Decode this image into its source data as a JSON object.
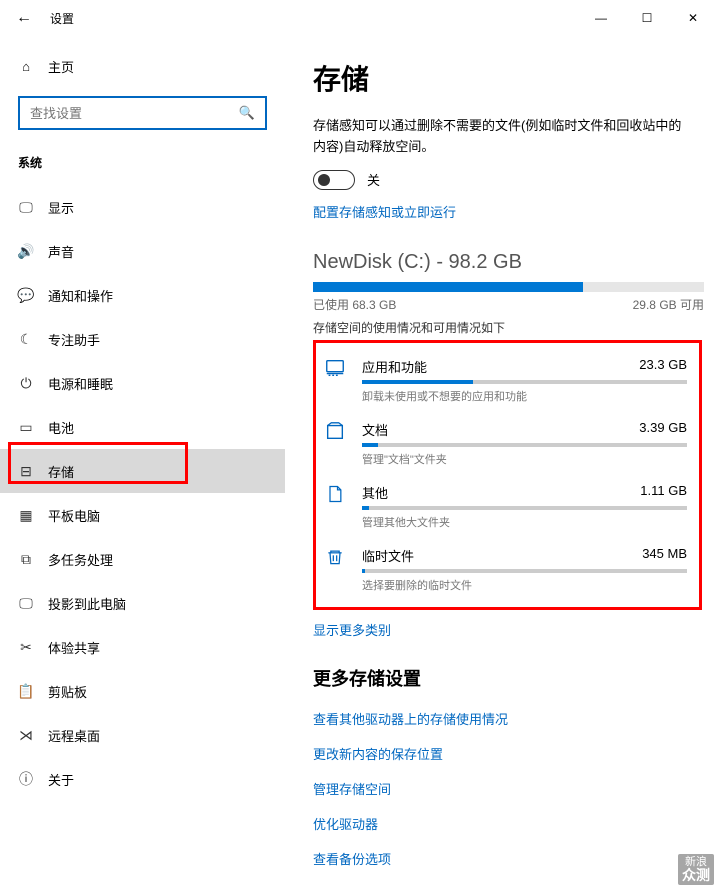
{
  "window": {
    "title": "设置",
    "min": "—",
    "max": "☐",
    "close": "✕",
    "back": "←"
  },
  "sidebar": {
    "home_label": "主页",
    "search_placeholder": "查找设置",
    "group_label": "系统",
    "items": [
      {
        "icon": "🖵",
        "label": "显示"
      },
      {
        "icon": "🔊",
        "label": "声音"
      },
      {
        "icon": "💬",
        "label": "通知和操作"
      },
      {
        "icon": "☾",
        "label": "专注助手"
      },
      {
        "icon": "⏻",
        "label": "电源和睡眠"
      },
      {
        "icon": "▭",
        "label": "电池"
      },
      {
        "icon": "⊟",
        "label": "存储"
      },
      {
        "icon": "▦",
        "label": "平板电脑"
      },
      {
        "icon": "⧉",
        "label": "多任务处理"
      },
      {
        "icon": "🖵",
        "label": "投影到此电脑"
      },
      {
        "icon": "✂",
        "label": "体验共享"
      },
      {
        "icon": "📋",
        "label": "剪贴板"
      },
      {
        "icon": "⋊",
        "label": "远程桌面"
      },
      {
        "icon": "ⓘ",
        "label": "关于"
      }
    ]
  },
  "main": {
    "heading": "存储",
    "desc": "存储感知可以通过删除不需要的文件(例如临时文件和回收站中的内容)自动释放空间。",
    "toggle_label": "关",
    "config_link": "配置存储感知或立即运行",
    "disk": {
      "title": "NewDisk (C:) - 98.2 GB",
      "used_label": "已使用 68.3 GB",
      "free_label": "29.8 GB 可用",
      "used_pct": 69,
      "trunc": "存储空间的使用情况和可用情况如下"
    },
    "categories": [
      {
        "icon": "apps",
        "title": "应用和功能",
        "size": "23.3 GB",
        "sub": "卸载未使用或不想要的应用和功能",
        "pct": 34
      },
      {
        "icon": "docs",
        "title": "文档",
        "size": "3.39 GB",
        "sub": "管理\"文档\"文件夹",
        "pct": 5
      },
      {
        "icon": "other",
        "title": "其他",
        "size": "1.11 GB",
        "sub": "管理其他大文件夹",
        "pct": 2
      },
      {
        "icon": "temp",
        "title": "临时文件",
        "size": "345 MB",
        "sub": "选择要删除的临时文件",
        "pct": 1
      }
    ],
    "show_more": "显示更多类别",
    "more_heading": "更多存储设置",
    "links": [
      "查看其他驱动器上的存储使用情况",
      "更改新内容的保存位置",
      "管理存储空间",
      "优化驱动器",
      "查看备份选项"
    ]
  },
  "watermark": {
    "l1": "新浪",
    "l2": "众测"
  }
}
